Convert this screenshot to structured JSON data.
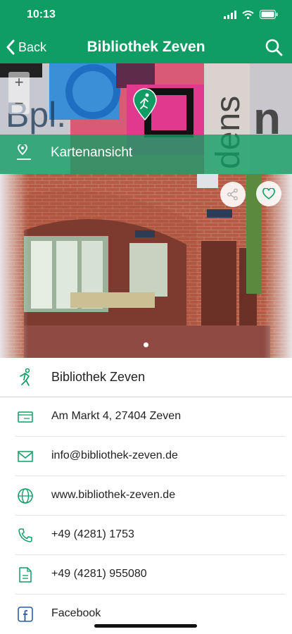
{
  "status_bar": {
    "time": "10:13"
  },
  "nav": {
    "back_label": "Back",
    "title": "Bibliothek Zeven"
  },
  "map": {
    "label": "Kartenansicht",
    "zoom_in": "+",
    "zoom_out": "−"
  },
  "colors": {
    "brand": "#0f9d63",
    "icon": "#0f9d63"
  },
  "details": [
    {
      "icon": "person-icon",
      "text": "Bibliothek Zeven"
    },
    {
      "icon": "address-card-icon",
      "text": "Am Markt 4, 27404 Zeven"
    },
    {
      "icon": "mail-icon",
      "text": "info@bibliothek-zeven.de"
    },
    {
      "icon": "globe-icon",
      "text": "www.bibliothek-zeven.de"
    },
    {
      "icon": "phone-icon",
      "text": "+49 (4281) 1753"
    },
    {
      "icon": "fax-icon",
      "text": "+49 (4281) 955080"
    },
    {
      "icon": "facebook-icon",
      "text": "Facebook"
    }
  ]
}
